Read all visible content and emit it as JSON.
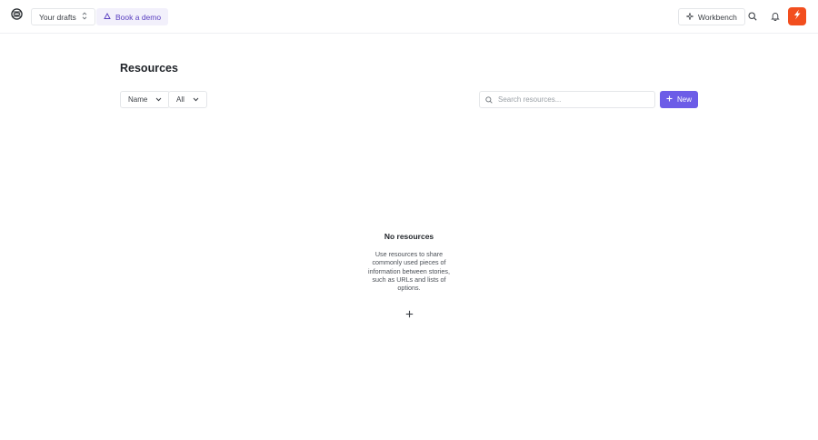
{
  "topbar": {
    "drafts_label": "Your drafts",
    "demo_label": "Book a demo",
    "workbench_label": "Workbench",
    "accent_color": "#6c5ce7",
    "brand_color": "#f24e1e"
  },
  "main": {
    "title": "Resources",
    "filters": {
      "name_label": "Name",
      "all_label": "All"
    },
    "search": {
      "placeholder": "Search resources..."
    },
    "new_label": "New",
    "empty_state": {
      "title": "No resources",
      "description": "Use resources to share commonly used pieces of information between stories, such as URLs and lists of options."
    }
  },
  "icons": [
    "app-logo-icon",
    "chevron-updown-icon",
    "demo-icon",
    "sparkle-icon",
    "search-icon",
    "bell-icon",
    "chevron-down-icon",
    "plus-icon"
  ]
}
